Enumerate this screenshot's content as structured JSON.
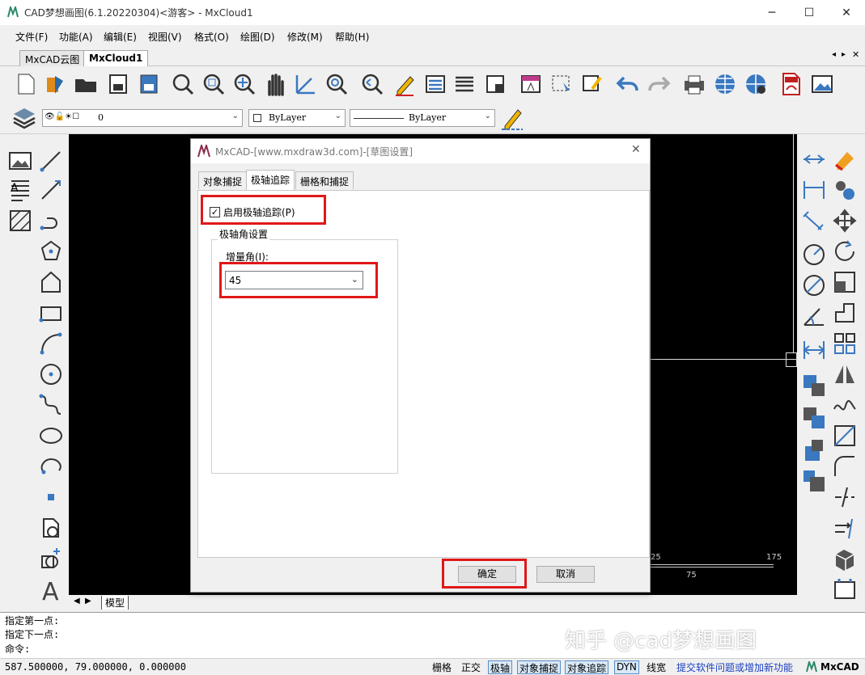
{
  "window": {
    "title": "CAD梦想画图(6.1.20220304)<游客> - MxCloud1",
    "minimize": "─",
    "maximize": "☐",
    "close": "✕"
  },
  "menu": [
    "文件(F)",
    "功能(A)",
    "编辑(E)",
    "视图(V)",
    "格式(O)",
    "绘图(D)",
    "修改(M)",
    "帮助(H)"
  ],
  "doc_tabs": [
    "MxCAD云图",
    "MxCloud1"
  ],
  "layer_toolbar": {
    "layer_value": "0",
    "color_value": "ByLayer",
    "linetype_value": "ByLayer"
  },
  "layout_tabs": {
    "model": "模型"
  },
  "command_lines": [
    "指定第一点:",
    "指定下一点:",
    "命令:"
  ],
  "status": {
    "coords": "587.500000,  79.000000,  0.000000",
    "buttons": [
      "栅格",
      "正交",
      "极轴",
      "对象捕捉",
      "对象追踪",
      "DYN",
      "线宽"
    ],
    "feedback_link": "提交软件问题或增加新功能",
    "brand": "MxCAD"
  },
  "watermark": "知乎 @cad梦想画图",
  "ruler": {
    "left": "25",
    "mid": "75",
    "right": "175"
  },
  "dialog": {
    "title": "MxCAD-[www.mxdraw3d.com]-[草图设置]",
    "tabs": [
      "对象捕捉",
      "极轴追踪",
      "栅格和捕捉"
    ],
    "enable_polar_label": "启用极轴追踪(P)",
    "enable_polar_checked": true,
    "group_label": "极轴角设置",
    "increment_label": "增量角(I):",
    "increment_value": "45",
    "ok_label": "确定",
    "cancel_label": "取消"
  },
  "colors": {
    "highlight_box": "#e01818",
    "accent": "#3a78c0"
  }
}
